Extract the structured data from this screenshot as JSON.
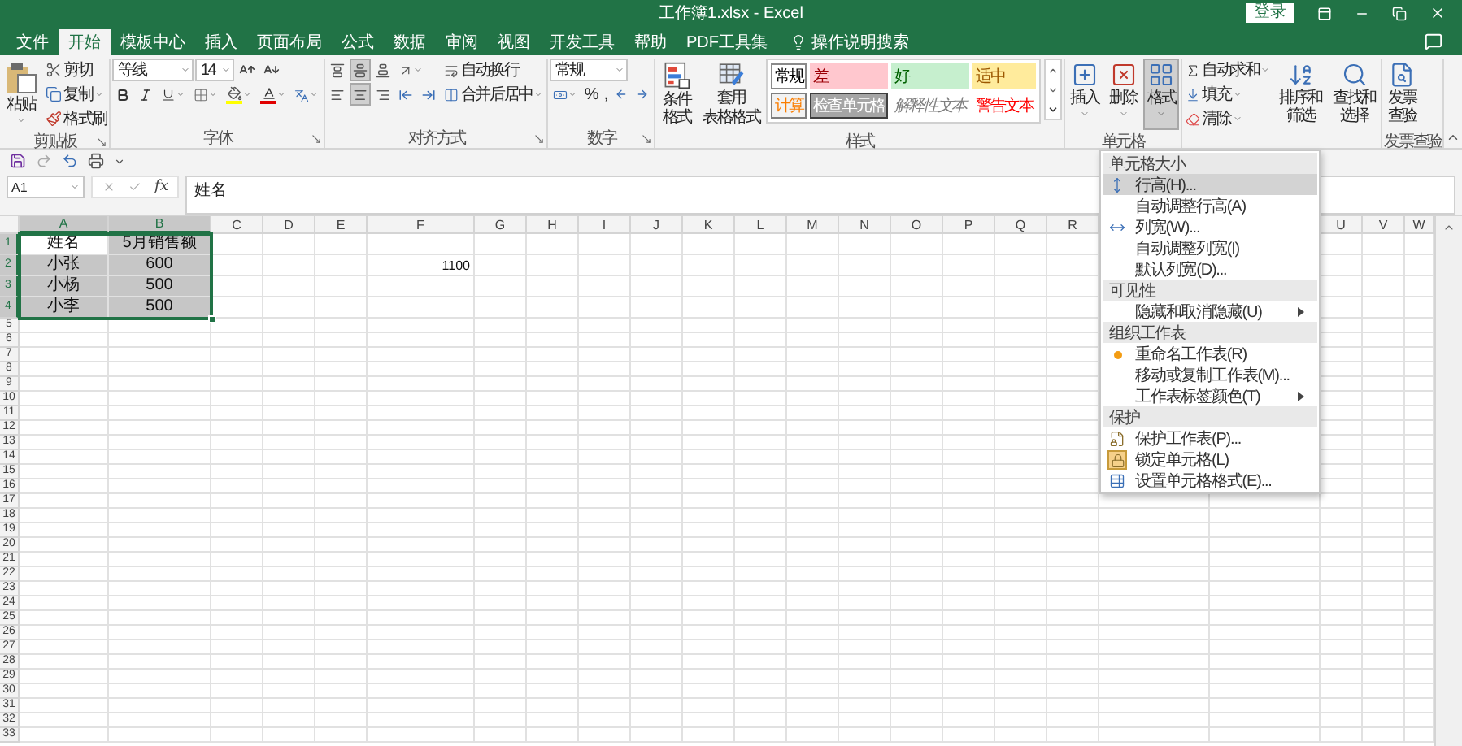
{
  "window": {
    "title": "工作簿1.xlsx - Excel",
    "login": "登录"
  },
  "tabs": [
    {
      "label": "文件",
      "selected": false
    },
    {
      "label": "开始",
      "selected": true
    },
    {
      "label": "模板中心",
      "selected": false
    },
    {
      "label": "插入",
      "selected": false
    },
    {
      "label": "页面布局",
      "selected": false
    },
    {
      "label": "公式",
      "selected": false
    },
    {
      "label": "数据",
      "selected": false
    },
    {
      "label": "审阅",
      "selected": false
    },
    {
      "label": "视图",
      "selected": false
    },
    {
      "label": "开发工具",
      "selected": false
    },
    {
      "label": "帮助",
      "selected": false
    },
    {
      "label": "PDF工具集",
      "selected": false
    }
  ],
  "tell_me": "操作说明搜索",
  "ribbon": {
    "clipboard": {
      "label": "剪贴板",
      "paste": "粘贴",
      "cut": "剪切",
      "copy": "复制",
      "format_painter": "格式刷"
    },
    "font": {
      "label": "字体",
      "font_name": "等线",
      "font_size": "14"
    },
    "alignment": {
      "label": "对齐方式",
      "vertical_buttons": [
        {
          "selected": false
        },
        {
          "selected": true
        },
        {
          "selected": false
        }
      ],
      "horizontal_buttons": [
        {
          "selected": false
        },
        {
          "selected": true
        },
        {
          "selected": false
        }
      ],
      "wrap": "自动换行",
      "merge": "合并后居中"
    },
    "number": {
      "label": "数字",
      "format": "常规",
      "percent": "%",
      "comma": ","
    },
    "styles": {
      "label": "样式",
      "conditional": "条件格式",
      "table_format": [
        "套用",
        "表格格式"
      ],
      "gallery": [
        {
          "label": "常规",
          "kind": "normal"
        },
        {
          "label": "差",
          "kind": "bad"
        },
        {
          "label": "好",
          "kind": "good"
        },
        {
          "label": "适中",
          "kind": "neutral"
        },
        {
          "label": "计算",
          "kind": "calculation"
        },
        {
          "label": "检查单元格",
          "kind": "check"
        },
        {
          "label": "解释性文本",
          "kind": "explanatory"
        },
        {
          "label": "警告文本",
          "kind": "warning"
        }
      ]
    },
    "cells": {
      "label": "单元格",
      "insert": "插入",
      "delete": "删除",
      "format": "格式",
      "format_pressed": true
    },
    "editing": {
      "autosum": "自动求和",
      "fill": "填充",
      "clear": "清除",
      "sort": "排序和筛选",
      "find": "查找和选择"
    },
    "invoice": {
      "label": "发票查验",
      "button": "发票查验"
    }
  },
  "formula_bar": {
    "name_box": "A1",
    "function_label": "fx",
    "value": "姓名"
  },
  "sheet": {
    "columns": [
      {
        "label": "A",
        "selected": true
      },
      {
        "label": "B",
        "selected": true
      },
      {
        "label": "C",
        "selected": false
      },
      {
        "label": "D",
        "selected": false
      },
      {
        "label": "E",
        "selected": false
      },
      {
        "label": "F",
        "selected": false
      },
      {
        "label": "G",
        "selected": false
      },
      {
        "label": "H",
        "selected": false
      },
      {
        "label": "I",
        "selected": false
      },
      {
        "label": "J",
        "selected": false
      },
      {
        "label": "K",
        "selected": false
      },
      {
        "label": "L",
        "selected": false
      },
      {
        "label": "M",
        "selected": false
      },
      {
        "label": "N",
        "selected": false
      },
      {
        "label": "O",
        "selected": false
      },
      {
        "label": "P",
        "selected": false
      },
      {
        "label": "Q",
        "selected": false
      },
      {
        "label": "R",
        "selected": false
      }
    ],
    "columns_right_of_menu": [
      {
        "label": "U",
        "selected": false
      },
      {
        "label": "V",
        "selected": false
      },
      {
        "label": "W",
        "selected": false
      }
    ],
    "rows": [
      {
        "number": "1",
        "selected": true,
        "cells": [
          {
            "text": "姓名",
            "selected": false
          },
          {
            "text": "5月销售额",
            "selected": true
          }
        ]
      },
      {
        "number": "2",
        "selected": true,
        "cells": [
          {
            "text": "小张",
            "selected": true
          },
          {
            "text": "600",
            "selected": true
          }
        ],
        "column_f": "1100"
      },
      {
        "number": "3",
        "selected": true,
        "cells": [
          {
            "text": "小杨",
            "selected": true
          },
          {
            "text": "500",
            "selected": true
          }
        ]
      },
      {
        "number": "4",
        "selected": true,
        "cells": [
          {
            "text": "小李",
            "selected": true
          },
          {
            "text": "500",
            "selected": true
          }
        ]
      }
    ],
    "more_row_numbers": [
      "5",
      "6",
      "7",
      "8",
      "9",
      "10",
      "11",
      "12",
      "13",
      "14",
      "15",
      "16",
      "17",
      "18",
      "19",
      "20",
      "21",
      "22",
      "23",
      "24",
      "25",
      "26",
      "27",
      "28",
      "29",
      "30",
      "31",
      "32",
      "33"
    ]
  },
  "format_menu": {
    "entries": [
      {
        "kind": "header",
        "label": "单元格大小"
      },
      {
        "kind": "item",
        "label": "行高(H)...",
        "selected": true,
        "submenu": false,
        "checked": false
      },
      {
        "kind": "item",
        "label": "自动调整行高(A)",
        "selected": false,
        "submenu": false,
        "checked": false
      },
      {
        "kind": "item",
        "label": "列宽(W)...",
        "selected": false,
        "submenu": false,
        "checked": false
      },
      {
        "kind": "item",
        "label": "自动调整列宽(I)",
        "selected": false,
        "submenu": false,
        "checked": false
      },
      {
        "kind": "item",
        "label": "默认列宽(D)...",
        "selected": false,
        "submenu": false,
        "checked": false
      },
      {
        "kind": "header",
        "label": "可见性"
      },
      {
        "kind": "item",
        "label": "隐藏和取消隐藏(U)",
        "selected": false,
        "submenu": true,
        "checked": false
      },
      {
        "kind": "header",
        "label": "组织工作表"
      },
      {
        "kind": "item",
        "label": "重命名工作表(R)",
        "selected": false,
        "submenu": false,
        "checked": false
      },
      {
        "kind": "item",
        "label": "移动或复制工作表(M)...",
        "selected": false,
        "submenu": false,
        "checked": false
      },
      {
        "kind": "item",
        "label": "工作表标签颜色(T)",
        "selected": false,
        "submenu": true,
        "checked": false
      },
      {
        "kind": "header",
        "label": "保护"
      },
      {
        "kind": "item",
        "label": "保护工作表(P)...",
        "selected": false,
        "submenu": false,
        "checked": false
      },
      {
        "kind": "item",
        "label": "锁定单元格(L)",
        "selected": false,
        "submenu": false,
        "checked": true
      },
      {
        "kind": "item",
        "label": "设置单元格格式(E)...",
        "selected": false,
        "submenu": false,
        "checked": false
      }
    ]
  }
}
